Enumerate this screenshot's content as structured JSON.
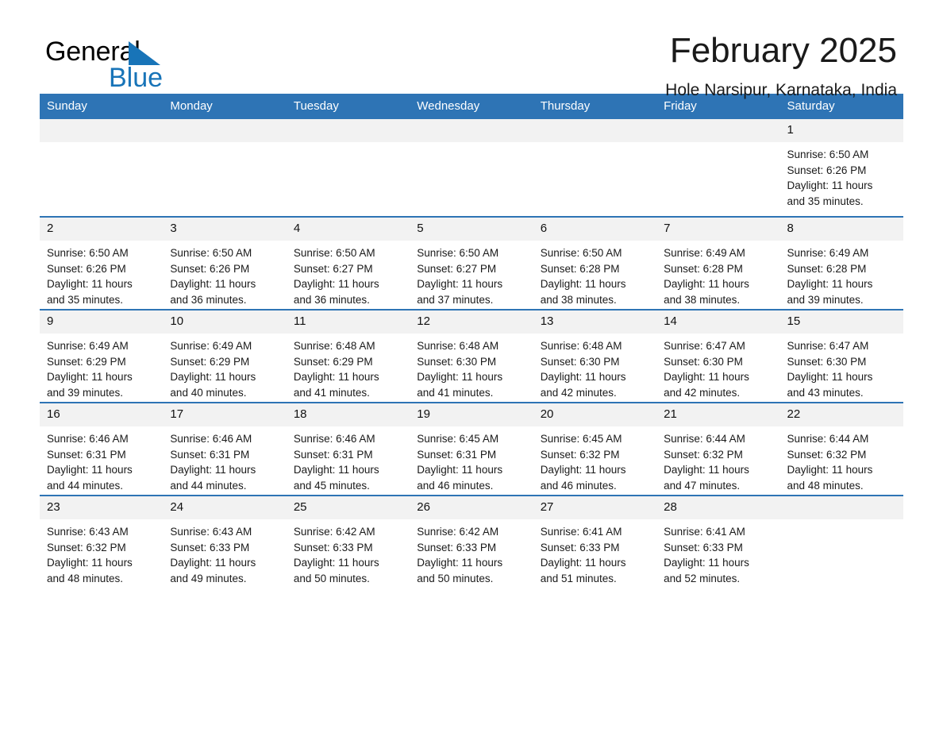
{
  "brand": {
    "line1": "General",
    "line2": "Blue",
    "triangle_color": "#1874b8",
    "text_color": "#000000"
  },
  "header": {
    "title": "February 2025",
    "subtitle": "Hole Narsipur, Karnataka, India"
  },
  "theme": {
    "header_row_bg": "#2e74b5",
    "header_row_text": "#ffffff",
    "daynum_bg": "#f2f2f2",
    "row_divider": "#2e74b5",
    "page_bg": "#ffffff"
  },
  "weekday_headers": [
    "Sunday",
    "Monday",
    "Tuesday",
    "Wednesday",
    "Thursday",
    "Friday",
    "Saturday"
  ],
  "labels": {
    "sunrise_prefix": "Sunrise:",
    "sunset_prefix": "Sunset:",
    "daylight_prefix": "Daylight:"
  },
  "weeks": [
    [
      {
        "blank": true,
        "day": ""
      },
      {
        "blank": true,
        "day": ""
      },
      {
        "blank": true,
        "day": ""
      },
      {
        "blank": true,
        "day": ""
      },
      {
        "blank": true,
        "day": ""
      },
      {
        "blank": true,
        "day": ""
      },
      {
        "blank": false,
        "day": "1",
        "sunrise": "Sunrise: 6:50 AM",
        "sunset": "Sunset: 6:26 PM",
        "daylight1": "Daylight: 11 hours",
        "daylight2": "and 35 minutes."
      }
    ],
    [
      {
        "blank": false,
        "day": "2",
        "sunrise": "Sunrise: 6:50 AM",
        "sunset": "Sunset: 6:26 PM",
        "daylight1": "Daylight: 11 hours",
        "daylight2": "and 35 minutes."
      },
      {
        "blank": false,
        "day": "3",
        "sunrise": "Sunrise: 6:50 AM",
        "sunset": "Sunset: 6:26 PM",
        "daylight1": "Daylight: 11 hours",
        "daylight2": "and 36 minutes."
      },
      {
        "blank": false,
        "day": "4",
        "sunrise": "Sunrise: 6:50 AM",
        "sunset": "Sunset: 6:27 PM",
        "daylight1": "Daylight: 11 hours",
        "daylight2": "and 36 minutes."
      },
      {
        "blank": false,
        "day": "5",
        "sunrise": "Sunrise: 6:50 AM",
        "sunset": "Sunset: 6:27 PM",
        "daylight1": "Daylight: 11 hours",
        "daylight2": "and 37 minutes."
      },
      {
        "blank": false,
        "day": "6",
        "sunrise": "Sunrise: 6:50 AM",
        "sunset": "Sunset: 6:28 PM",
        "daylight1": "Daylight: 11 hours",
        "daylight2": "and 38 minutes."
      },
      {
        "blank": false,
        "day": "7",
        "sunrise": "Sunrise: 6:49 AM",
        "sunset": "Sunset: 6:28 PM",
        "daylight1": "Daylight: 11 hours",
        "daylight2": "and 38 minutes."
      },
      {
        "blank": false,
        "day": "8",
        "sunrise": "Sunrise: 6:49 AM",
        "sunset": "Sunset: 6:28 PM",
        "daylight1": "Daylight: 11 hours",
        "daylight2": "and 39 minutes."
      }
    ],
    [
      {
        "blank": false,
        "day": "9",
        "sunrise": "Sunrise: 6:49 AM",
        "sunset": "Sunset: 6:29 PM",
        "daylight1": "Daylight: 11 hours",
        "daylight2": "and 39 minutes."
      },
      {
        "blank": false,
        "day": "10",
        "sunrise": "Sunrise: 6:49 AM",
        "sunset": "Sunset: 6:29 PM",
        "daylight1": "Daylight: 11 hours",
        "daylight2": "and 40 minutes."
      },
      {
        "blank": false,
        "day": "11",
        "sunrise": "Sunrise: 6:48 AM",
        "sunset": "Sunset: 6:29 PM",
        "daylight1": "Daylight: 11 hours",
        "daylight2": "and 41 minutes."
      },
      {
        "blank": false,
        "day": "12",
        "sunrise": "Sunrise: 6:48 AM",
        "sunset": "Sunset: 6:30 PM",
        "daylight1": "Daylight: 11 hours",
        "daylight2": "and 41 minutes."
      },
      {
        "blank": false,
        "day": "13",
        "sunrise": "Sunrise: 6:48 AM",
        "sunset": "Sunset: 6:30 PM",
        "daylight1": "Daylight: 11 hours",
        "daylight2": "and 42 minutes."
      },
      {
        "blank": false,
        "day": "14",
        "sunrise": "Sunrise: 6:47 AM",
        "sunset": "Sunset: 6:30 PM",
        "daylight1": "Daylight: 11 hours",
        "daylight2": "and 42 minutes."
      },
      {
        "blank": false,
        "day": "15",
        "sunrise": "Sunrise: 6:47 AM",
        "sunset": "Sunset: 6:30 PM",
        "daylight1": "Daylight: 11 hours",
        "daylight2": "and 43 minutes."
      }
    ],
    [
      {
        "blank": false,
        "day": "16",
        "sunrise": "Sunrise: 6:46 AM",
        "sunset": "Sunset: 6:31 PM",
        "daylight1": "Daylight: 11 hours",
        "daylight2": "and 44 minutes."
      },
      {
        "blank": false,
        "day": "17",
        "sunrise": "Sunrise: 6:46 AM",
        "sunset": "Sunset: 6:31 PM",
        "daylight1": "Daylight: 11 hours",
        "daylight2": "and 44 minutes."
      },
      {
        "blank": false,
        "day": "18",
        "sunrise": "Sunrise: 6:46 AM",
        "sunset": "Sunset: 6:31 PM",
        "daylight1": "Daylight: 11 hours",
        "daylight2": "and 45 minutes."
      },
      {
        "blank": false,
        "day": "19",
        "sunrise": "Sunrise: 6:45 AM",
        "sunset": "Sunset: 6:31 PM",
        "daylight1": "Daylight: 11 hours",
        "daylight2": "and 46 minutes."
      },
      {
        "blank": false,
        "day": "20",
        "sunrise": "Sunrise: 6:45 AM",
        "sunset": "Sunset: 6:32 PM",
        "daylight1": "Daylight: 11 hours",
        "daylight2": "and 46 minutes."
      },
      {
        "blank": false,
        "day": "21",
        "sunrise": "Sunrise: 6:44 AM",
        "sunset": "Sunset: 6:32 PM",
        "daylight1": "Daylight: 11 hours",
        "daylight2": "and 47 minutes."
      },
      {
        "blank": false,
        "day": "22",
        "sunrise": "Sunrise: 6:44 AM",
        "sunset": "Sunset: 6:32 PM",
        "daylight1": "Daylight: 11 hours",
        "daylight2": "and 48 minutes."
      }
    ],
    [
      {
        "blank": false,
        "day": "23",
        "sunrise": "Sunrise: 6:43 AM",
        "sunset": "Sunset: 6:32 PM",
        "daylight1": "Daylight: 11 hours",
        "daylight2": "and 48 minutes."
      },
      {
        "blank": false,
        "day": "24",
        "sunrise": "Sunrise: 6:43 AM",
        "sunset": "Sunset: 6:33 PM",
        "daylight1": "Daylight: 11 hours",
        "daylight2": "and 49 minutes."
      },
      {
        "blank": false,
        "day": "25",
        "sunrise": "Sunrise: 6:42 AM",
        "sunset": "Sunset: 6:33 PM",
        "daylight1": "Daylight: 11 hours",
        "daylight2": "and 50 minutes."
      },
      {
        "blank": false,
        "day": "26",
        "sunrise": "Sunrise: 6:42 AM",
        "sunset": "Sunset: 6:33 PM",
        "daylight1": "Daylight: 11 hours",
        "daylight2": "and 50 minutes."
      },
      {
        "blank": false,
        "day": "27",
        "sunrise": "Sunrise: 6:41 AM",
        "sunset": "Sunset: 6:33 PM",
        "daylight1": "Daylight: 11 hours",
        "daylight2": "and 51 minutes."
      },
      {
        "blank": false,
        "day": "28",
        "sunrise": "Sunrise: 6:41 AM",
        "sunset": "Sunset: 6:33 PM",
        "daylight1": "Daylight: 11 hours",
        "daylight2": "and 52 minutes."
      },
      {
        "blank": true,
        "day": ""
      }
    ]
  ]
}
